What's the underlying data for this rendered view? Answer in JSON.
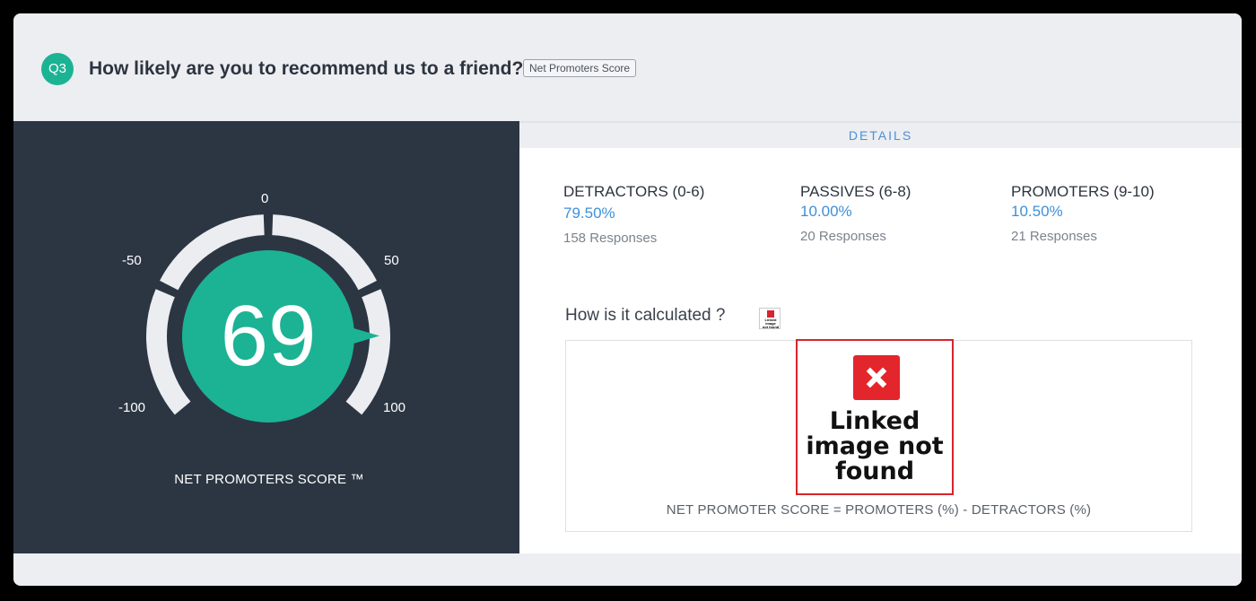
{
  "question": {
    "badge": "Q3",
    "title": "How likely are you to recommend us to a friend?",
    "tag": "Net Promoters Score"
  },
  "gauge": {
    "score": "69",
    "score_value": 69,
    "range": [
      -100,
      100
    ],
    "ticks": [
      "0",
      "-50",
      "50",
      "-100",
      "100"
    ],
    "caption": "NET PROMOTERS SCORE ™",
    "colors": {
      "score": "#1bb394",
      "track": "#ebedf0",
      "panel": "#2c3643"
    }
  },
  "details": {
    "header": "DETAILS",
    "stats": [
      {
        "label": "DETRACTORS (0-6)",
        "percent": "79.50%",
        "responses": "158 Responses"
      },
      {
        "label": "PASSIVES (6-8)",
        "percent": "10.00%",
        "responses": "20 Responses"
      },
      {
        "label": "PROMOTERS (9-10)",
        "percent": "10.50%",
        "responses": "21 Responses"
      }
    ],
    "calc_title": "How is it calculated ?",
    "broken_image_text": "Linked image not found",
    "formula": "NET PROMOTER SCORE = PROMOTERS (%) - DETRACTORS (%)"
  }
}
